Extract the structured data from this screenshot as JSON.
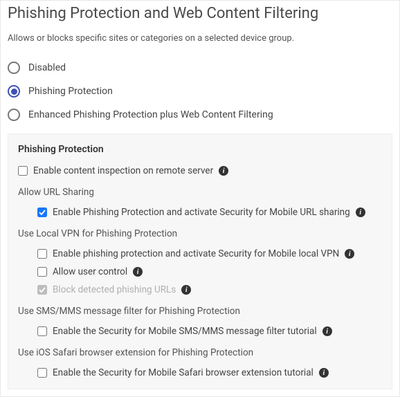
{
  "title": "Phishing Protection and Web Content Filtering",
  "description": "Allows or blocks specific sites or categories on a selected device group.",
  "radios": {
    "disabled": "Disabled",
    "phishing": "Phishing Protection",
    "enhanced": "Enhanced Phishing Protection plus Web Content Filtering",
    "selected": "phishing"
  },
  "panel": {
    "title": "Phishing Protection",
    "cb_content_inspection": {
      "label": "Enable content inspection on remote server",
      "checked": false
    },
    "section_url_sharing": "Allow URL Sharing",
    "cb_url_sharing": {
      "label": "Enable Phishing Protection and activate Security for Mobile URL sharing",
      "checked": true
    },
    "section_local_vpn": "Use Local VPN for Phishing Protection",
    "cb_local_vpn": {
      "label": "Enable phishing protection and activate Security for Mobile local VPN",
      "checked": false
    },
    "cb_user_control": {
      "label": "Allow user control",
      "checked": false
    },
    "cb_block_detected": {
      "label": "Block detected phishing URLs",
      "checked": true,
      "disabled": true
    },
    "section_sms": "Use SMS/MMS message filter for Phishing Protection",
    "cb_sms": {
      "label": "Enable the Security for Mobile SMS/MMS message filter tutorial",
      "checked": false
    },
    "section_safari": "Use iOS Safari browser extension for Phishing Protection",
    "cb_safari": {
      "label": "Enable the Security for Mobile Safari browser extension tutorial",
      "checked": false
    }
  }
}
